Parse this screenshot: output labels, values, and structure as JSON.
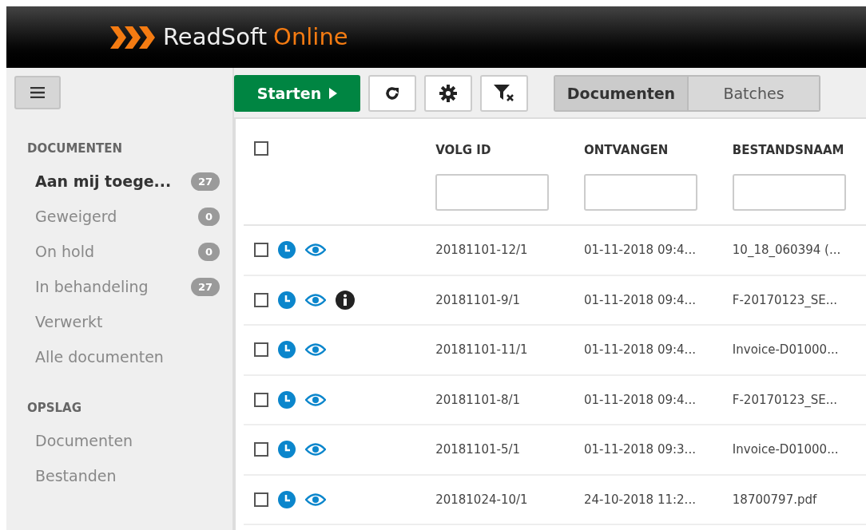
{
  "header": {
    "brand": "ReadSoft",
    "brand_suffix": "Online"
  },
  "toolbar": {
    "start_button": "Starten",
    "view_toggle": [
      {
        "label": "Documenten",
        "selected": true
      },
      {
        "label": "Batches",
        "selected": false
      }
    ]
  },
  "sidebar": {
    "sections": [
      {
        "title": "DOCUMENTEN",
        "items": [
          {
            "label": "Aan mij toege...",
            "count": "27",
            "selected": true
          },
          {
            "label": "Geweigerd",
            "count": "0",
            "selected": false
          },
          {
            "label": "On hold",
            "count": "0",
            "selected": false
          },
          {
            "label": "In behandeling",
            "count": "27",
            "selected": false
          },
          {
            "label": "Verwerkt",
            "selected": false
          },
          {
            "label": "Alle documenten",
            "selected": false
          }
        ]
      },
      {
        "title": "OPSLAG",
        "items": [
          {
            "label": "Documenten",
            "selected": false
          },
          {
            "label": "Bestanden",
            "selected": false
          }
        ]
      }
    ]
  },
  "table": {
    "select_all_checked": false,
    "columns": [
      "VOLG ID",
      "ONTVANGEN",
      "BESTANDSNAAM"
    ],
    "rows": [
      {
        "checked": false,
        "info": false,
        "cells": [
          "20181101-12/1",
          "01-11-2018 09:4...",
          "10_18_060394 (..."
        ]
      },
      {
        "checked": false,
        "info": true,
        "cells": [
          "20181101-9/1",
          "01-11-2018 09:4...",
          "F-20170123_SE..."
        ]
      },
      {
        "checked": false,
        "info": false,
        "cells": [
          "20181101-11/1",
          "01-11-2018 09:4...",
          "Invoice-D01000..."
        ]
      },
      {
        "checked": false,
        "info": false,
        "cells": [
          "20181101-8/1",
          "01-11-2018 09:4...",
          "F-20170123_SE..."
        ]
      },
      {
        "checked": false,
        "info": false,
        "cells": [
          "20181101-5/1",
          "01-11-2018 09:3...",
          "Invoice-D01000..."
        ]
      },
      {
        "checked": false,
        "info": false,
        "cells": [
          "20181024-10/1",
          "24-10-2018 11:2...",
          "18700797.pdf"
        ]
      }
    ]
  }
}
